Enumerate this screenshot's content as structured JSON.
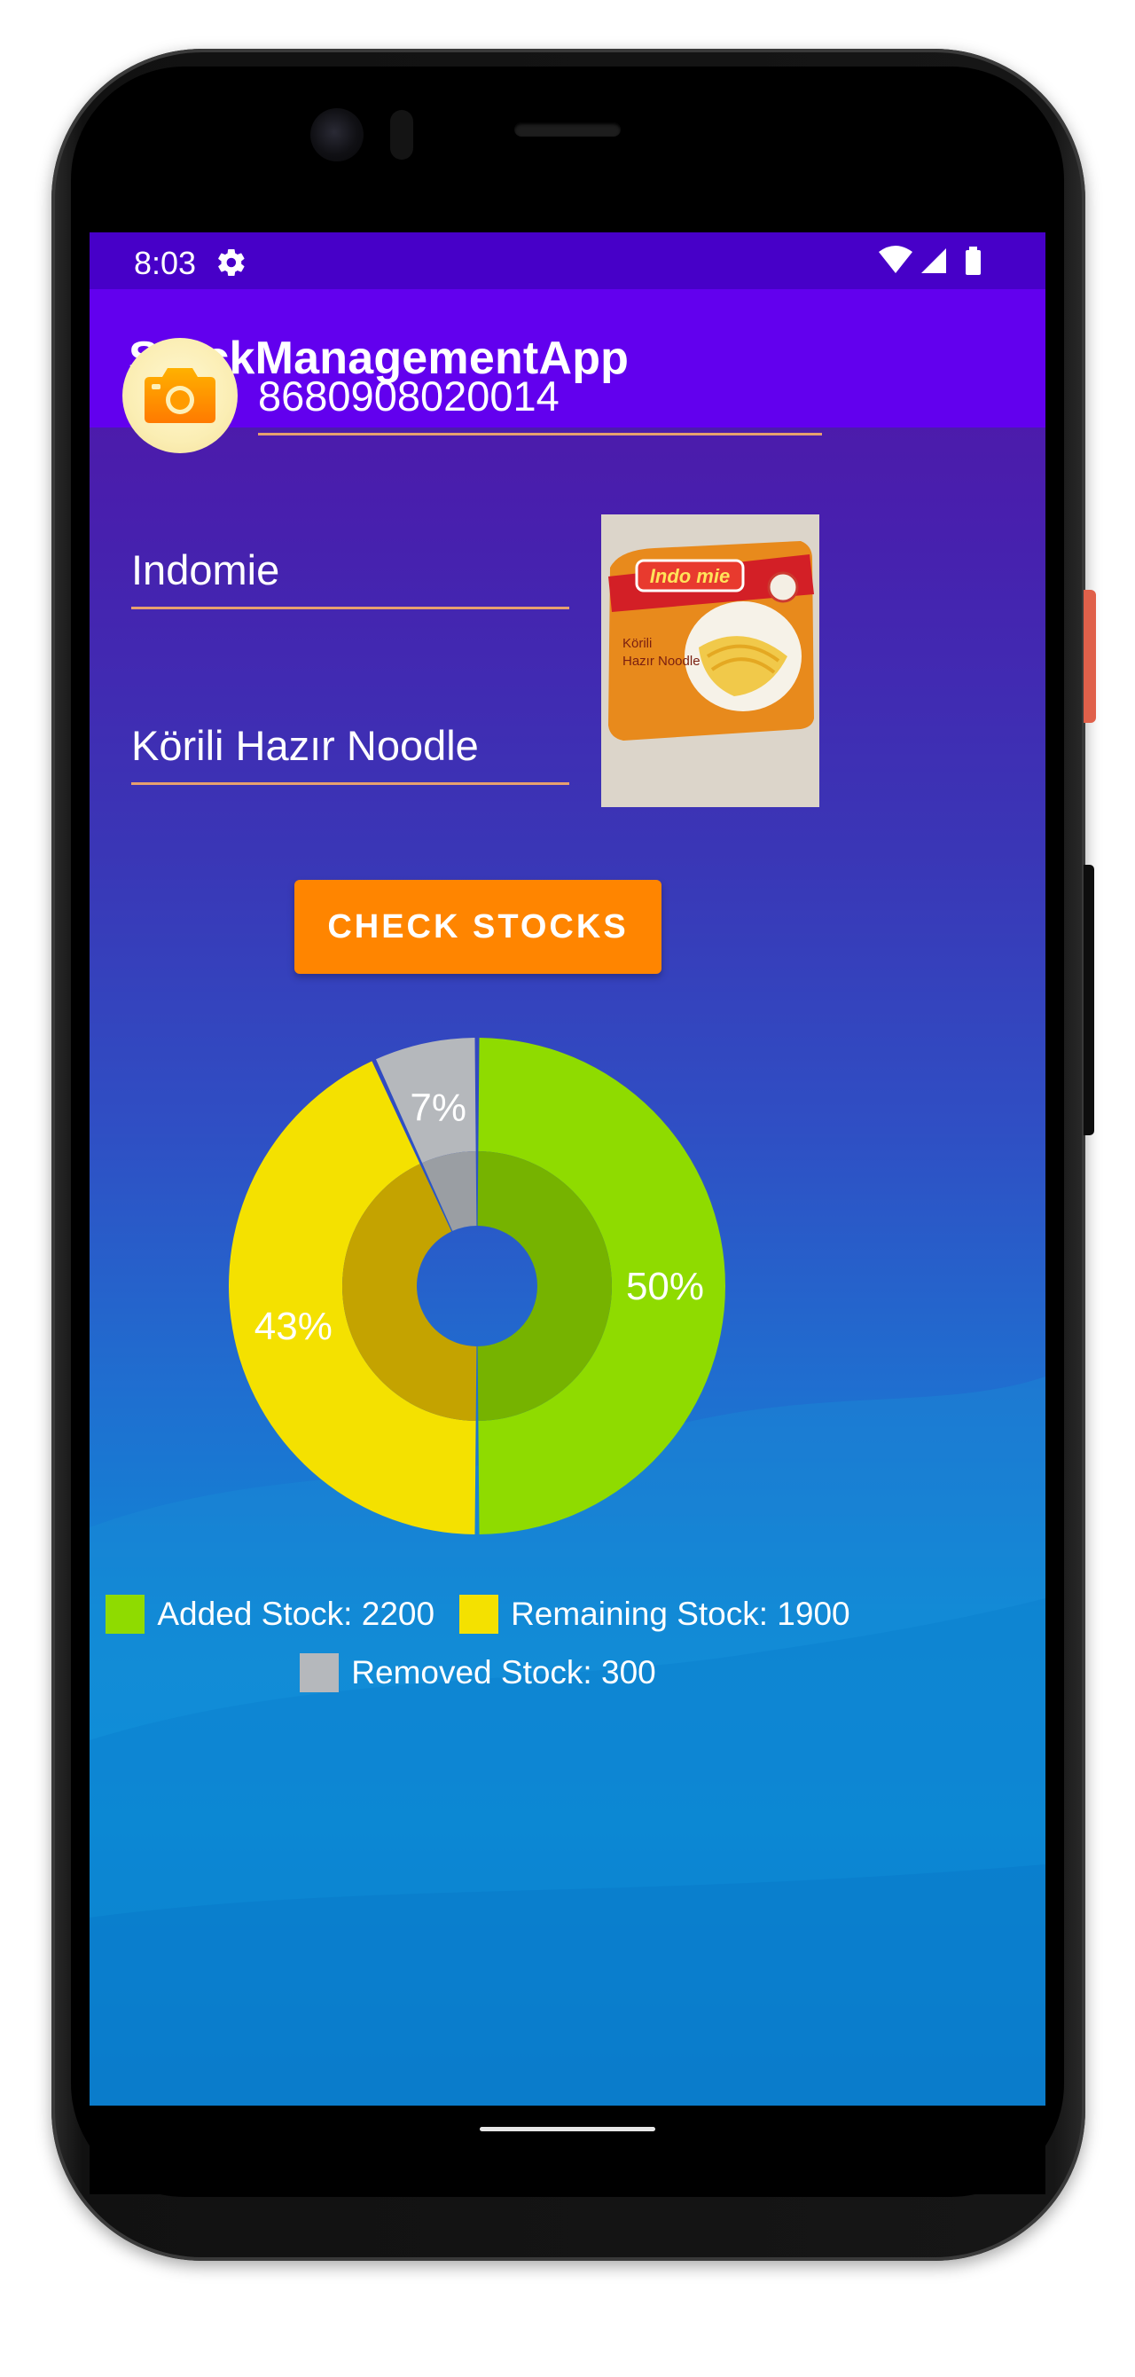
{
  "status_bar": {
    "time": "8:03",
    "icons": [
      "gear-icon",
      "wifi-icon",
      "signal-icon",
      "battery-icon"
    ]
  },
  "app_bar": {
    "title": "StockManagementApp",
    "color": "#6200ee"
  },
  "form": {
    "barcode_value": "8680908020014",
    "brand_value": "Indomie",
    "product_name_value": "Körili Hazır Noodle",
    "camera_icon": "camera-icon",
    "product_image_text": [
      "Indo mie",
      "Körili",
      "Hazır Noodle"
    ]
  },
  "actions": {
    "check_stocks_label": "CHECK STOCKS",
    "button_color": "#ff8500"
  },
  "chart_data": {
    "type": "pie",
    "style": "donut",
    "labels": [
      "Added Stock",
      "Remaining Stock",
      "Removed Stock"
    ],
    "values": [
      2200,
      1900,
      300
    ],
    "percent_labels": [
      "50%",
      "43%",
      "7%"
    ],
    "colors": [
      "#8fdb00",
      "#f4e100",
      "#b5b8bc"
    ],
    "legend": [
      "Added Stock: 2200",
      "Remaining Stock: 1900",
      "Removed Stock: 300"
    ],
    "legend_position": "bottom"
  }
}
